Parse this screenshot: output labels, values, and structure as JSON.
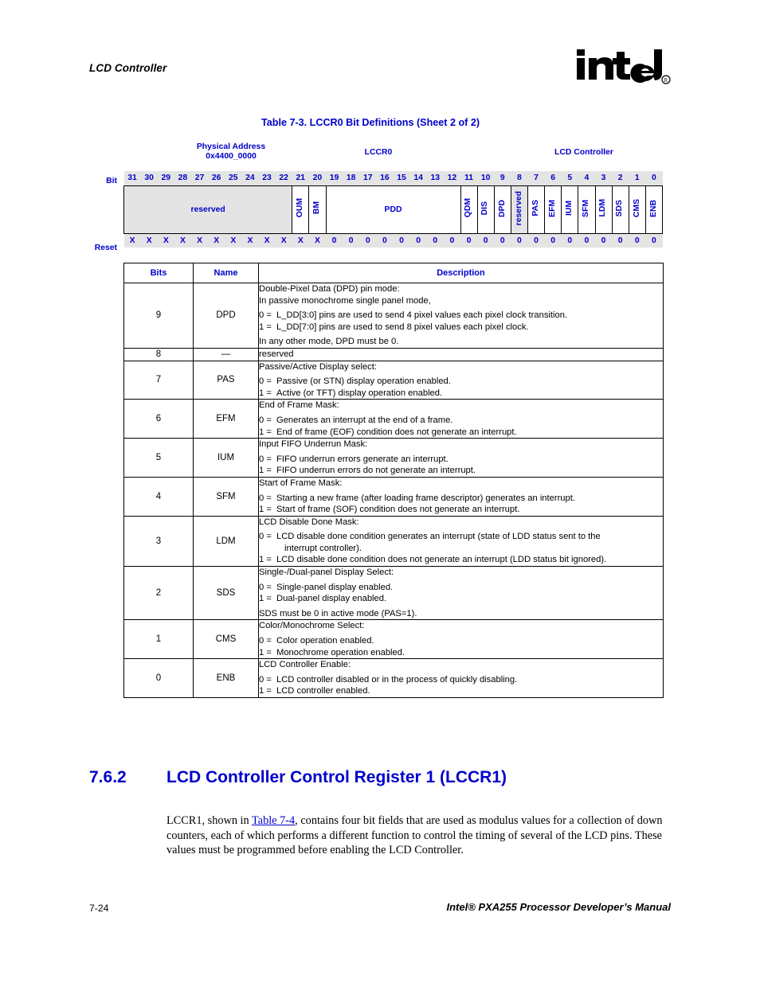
{
  "page": {
    "running_head": "LCD Controller",
    "logo_alt": "intel-logo",
    "footer_left": "7-24",
    "footer_right": "Intel® PXA255 Processor Developer’s Manual"
  },
  "table": {
    "caption": "Table 7-3. LCCR0 Bit Definitions (Sheet 2 of 2)",
    "header": {
      "physical_address": "Physical Address\n0x4400_0000",
      "register": "LCCR0",
      "unit": "LCD Controller"
    },
    "row_labels": {
      "bit": "Bit",
      "reset": "Reset"
    },
    "bit_numbers": [
      "31",
      "30",
      "29",
      "28",
      "27",
      "26",
      "25",
      "24",
      "23",
      "22",
      "21",
      "20",
      "19",
      "18",
      "17",
      "16",
      "15",
      "14",
      "13",
      "12",
      "11",
      "10",
      "9",
      "8",
      "7",
      "6",
      "5",
      "4",
      "3",
      "2",
      "1",
      "0"
    ],
    "fields": [
      {
        "label": "reserved",
        "span": 10,
        "shaded": true,
        "vertical": false
      },
      {
        "label": "OUM",
        "span": 1,
        "shaded": false,
        "vertical": true
      },
      {
        "label": "BM",
        "span": 1,
        "shaded": false,
        "vertical": true
      },
      {
        "label": "PDD",
        "span": 8,
        "shaded": false,
        "vertical": false
      },
      {
        "label": "QDM",
        "span": 1,
        "shaded": false,
        "vertical": true
      },
      {
        "label": "DIS",
        "span": 1,
        "shaded": false,
        "vertical": true
      },
      {
        "label": "DPD",
        "span": 1,
        "shaded": false,
        "vertical": true
      },
      {
        "label": "reserved",
        "span": 1,
        "shaded": true,
        "vertical": true
      },
      {
        "label": "PAS",
        "span": 1,
        "shaded": false,
        "vertical": true
      },
      {
        "label": "EFM",
        "span": 1,
        "shaded": false,
        "vertical": true
      },
      {
        "label": "IUM",
        "span": 1,
        "shaded": false,
        "vertical": true
      },
      {
        "label": "SFM",
        "span": 1,
        "shaded": false,
        "vertical": true
      },
      {
        "label": "LDM",
        "span": 1,
        "shaded": false,
        "vertical": true
      },
      {
        "label": "SDS",
        "span": 1,
        "shaded": false,
        "vertical": true
      },
      {
        "label": "CMS",
        "span": 1,
        "shaded": false,
        "vertical": true
      },
      {
        "label": "ENB",
        "span": 1,
        "shaded": false,
        "vertical": true
      }
    ],
    "reset_values": [
      "X",
      "X",
      "X",
      "X",
      "X",
      "X",
      "X",
      "X",
      "X",
      "X",
      "X",
      "X",
      "0",
      "0",
      "0",
      "0",
      "0",
      "0",
      "0",
      "0",
      "0",
      "0",
      "0",
      "0",
      "0",
      "0",
      "0",
      "0",
      "0",
      "0",
      "0",
      "0"
    ],
    "columns": {
      "bits": "Bits",
      "name": "Name",
      "description": "Description"
    },
    "rows": [
      {
        "bits": "9",
        "name": "DPD",
        "lines": [
          {
            "type": "text",
            "text": "Double-Pixel Data (DPD) pin mode:"
          },
          {
            "type": "text",
            "text": "In passive monochrome single panel mode,"
          },
          {
            "type": "opt",
            "key": "0 =",
            "value": "L_DD[3:0] pins are used to send 4 pixel values each pixel clock transition."
          },
          {
            "type": "opt",
            "key": "1 =",
            "value": "L_DD[7:0] pins are used to send 8 pixel values each pixel clock."
          },
          {
            "type": "text",
            "text": "In any other mode, DPD must be 0."
          }
        ]
      },
      {
        "bits": "8",
        "name": "—",
        "lines": [
          {
            "type": "text",
            "text": "reserved"
          }
        ]
      },
      {
        "bits": "7",
        "name": "PAS",
        "lines": [
          {
            "type": "text",
            "text": "Passive/Active Display select:"
          },
          {
            "type": "opt",
            "key": "0 =",
            "value": "Passive (or STN) display operation enabled."
          },
          {
            "type": "opt",
            "key": "1 =",
            "value": "Active (or TFT) display operation enabled."
          }
        ]
      },
      {
        "bits": "6",
        "name": "EFM",
        "lines": [
          {
            "type": "text",
            "text": "End of Frame Mask:"
          },
          {
            "type": "opt",
            "key": "0 =",
            "value": "Generates an interrupt at the end of a frame."
          },
          {
            "type": "opt",
            "key": "1 =",
            "value": "End of frame (EOF) condition does not generate an interrupt."
          }
        ]
      },
      {
        "bits": "5",
        "name": "IUM",
        "lines": [
          {
            "type": "text",
            "text": "Input FIFO Underrun Mask:"
          },
          {
            "type": "opt",
            "key": "0 =",
            "value": "FIFO underrun errors generate an interrupt."
          },
          {
            "type": "opt",
            "key": "1 =",
            "value": "FIFO underrun errors do not generate an interrupt."
          }
        ]
      },
      {
        "bits": "4",
        "name": "SFM",
        "lines": [
          {
            "type": "text",
            "text": "Start of Frame Mask:"
          },
          {
            "type": "opt",
            "key": "0 =",
            "value": "Starting a new frame (after loading frame descriptor) generates an interrupt."
          },
          {
            "type": "opt",
            "key": "1 =",
            "value": "Start of frame (SOF) condition does not generate an interrupt."
          }
        ]
      },
      {
        "bits": "3",
        "name": "LDM",
        "lines": [
          {
            "type": "text",
            "text": "LCD Disable Done Mask:"
          },
          {
            "type": "opt",
            "key": "0 =",
            "value": "LCD disable done condition generates an interrupt (state of LDD status sent to the",
            "cont": "interrupt controller)."
          },
          {
            "type": "opt",
            "key": "1 =",
            "value": "LCD disable done condition does not generate an interrupt (LDD status bit ignored)."
          }
        ]
      },
      {
        "bits": "2",
        "name": "SDS",
        "lines": [
          {
            "type": "text",
            "text": "Single-/Dual-panel Display Select:"
          },
          {
            "type": "opt",
            "key": "0 =",
            "value": "Single-panel display enabled."
          },
          {
            "type": "opt",
            "key": "1 =",
            "value": "Dual-panel display enabled."
          },
          {
            "type": "text",
            "text": "SDS must be 0 in active mode (PAS=1)."
          }
        ]
      },
      {
        "bits": "1",
        "name": "CMS",
        "lines": [
          {
            "type": "text",
            "text": "Color/Monochrome Select:"
          },
          {
            "type": "opt",
            "key": "0 =",
            "value": "Color operation enabled."
          },
          {
            "type": "opt",
            "key": "1 =",
            "value": "Monochrome operation enabled."
          }
        ]
      },
      {
        "bits": "0",
        "name": "ENB",
        "lines": [
          {
            "type": "text",
            "text": "LCD Controller Enable:"
          },
          {
            "type": "opt",
            "key": "0 =",
            "value": "LCD controller disabled or in the process of quickly disabling."
          },
          {
            "type": "opt",
            "key": "1 =",
            "value": "LCD controller enabled."
          }
        ]
      }
    ]
  },
  "section": {
    "number": "7.6.2",
    "title": "LCD Controller Control Register 1 (LCCR1)",
    "paragraph": {
      "before": "LCCR1, shown in ",
      "link": "Table 7-4",
      "after": ", contains four bit fields that are used as modulus values for a collection of down counters, each of which performs a different function to control the timing of several of the LCD pins. These values must be programmed before enabling the LCD Controller."
    }
  },
  "colors": {
    "heading_blue": "#0000CC",
    "shade_gray": "#e4e4e4",
    "text_black": "#000000"
  }
}
